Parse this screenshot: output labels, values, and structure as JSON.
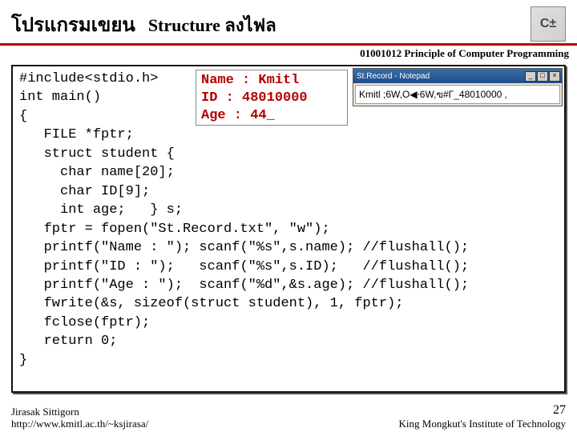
{
  "header": {
    "title_thai": "โปรแกรมเขยน",
    "title_en": "Structure ลงไฟล",
    "logo_text": "C±"
  },
  "subtitle": "01001012 Principle of Computer Programming",
  "code_text": "#include<stdio.h>\nint main()\n{\n   FILE *fptr;\n   struct student {\n     char name[20];\n     char ID[9];\n     int age;   } s;\n   fptr = fopen(\"St.Record.txt\", \"w\");\n   printf(\"Name : \"); scanf(\"%s\",s.name); //flushall();\n   printf(\"ID : \");   scanf(\"%s\",s.ID);   //flushall();\n   printf(\"Age : \");  scanf(\"%d\",&s.age); //flushall();\n   fwrite(&s, sizeof(struct student), 1, fptr);\n   fclose(fptr);\n   return 0;\n}",
  "console": {
    "l1": "Name : Kmitl",
    "l2": "ID : 48010000",
    "l3": "Age : 44_"
  },
  "notepad": {
    "title": "St.Record - Notepad",
    "content": "Kmitl ;6W,O◀⸱6W,ฃ#Γ_48010000 ,",
    "btn_min": "_",
    "btn_max": "□",
    "btn_close": "×"
  },
  "footer": {
    "author": "Jirasak Sittigorn",
    "url": "http://www.kmitl.ac.th/~ksjirasa/",
    "slide_num": "27",
    "institute": "King Mongkut's Institute of Technology"
  }
}
